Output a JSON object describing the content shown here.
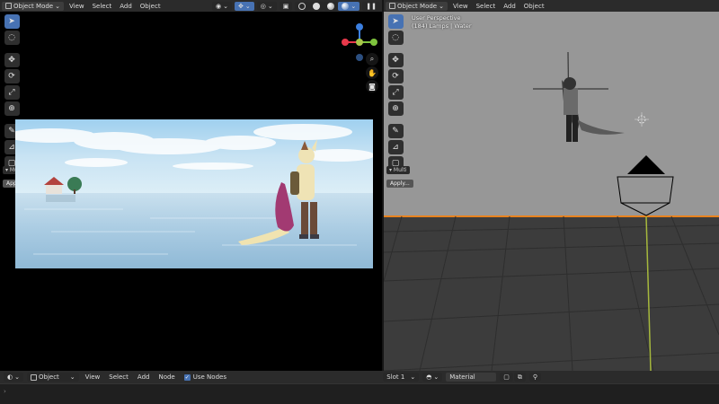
{
  "left_header": {
    "mode": "Object Mode",
    "menus": [
      "View",
      "Select",
      "Add",
      "Object"
    ]
  },
  "right_header": {
    "mode": "Object Mode",
    "menus": [
      "View",
      "Select",
      "Add",
      "Object"
    ]
  },
  "left_viewport": {
    "panel_tab": "Multi",
    "apply_label": "Apply..."
  },
  "right_viewport": {
    "overlay_line1": "User Perspective",
    "overlay_line2": "(184) Lamps | Water",
    "panel_tab": "Multi",
    "apply_label": "Apply..."
  },
  "footer": {
    "editor_mode": "Object",
    "menus": [
      "View",
      "Select",
      "Add",
      "Node"
    ],
    "use_nodes_label": "Use Nodes",
    "slot_label": "Slot 1",
    "material_name": "Material"
  },
  "colors": {
    "accent": "#4772b3",
    "horizon_orange": "#e8821e",
    "axis_x": "#e8394b",
    "axis_y": "#7ec33d",
    "axis_z": "#3b7fe0"
  }
}
